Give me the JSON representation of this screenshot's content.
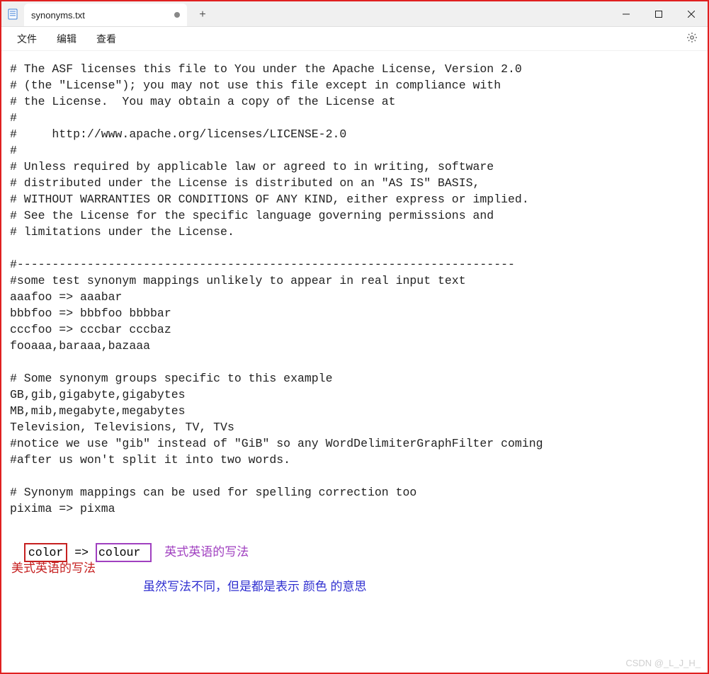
{
  "titlebar": {
    "tab_title": "synonyms.txt",
    "modified": true
  },
  "menu": {
    "file": "文件",
    "edit": "编辑",
    "view": "查看"
  },
  "content": {
    "lines": [
      "# The ASF licenses this file to You under the Apache License, Version 2.0",
      "# (the \"License\"); you may not use this file except in compliance with",
      "# the License.  You may obtain a copy of the License at",
      "#",
      "#     http://www.apache.org/licenses/LICENSE-2.0",
      "#",
      "# Unless required by applicable law or agreed to in writing, software",
      "# distributed under the License is distributed on an \"AS IS\" BASIS,",
      "# WITHOUT WARRANTIES OR CONDITIONS OF ANY KIND, either express or implied.",
      "# See the License for the specific language governing permissions and",
      "# limitations under the License.",
      "",
      "#-----------------------------------------------------------------------",
      "#some test synonym mappings unlikely to appear in real input text",
      "aaafoo => aaabar",
      "bbbfoo => bbbfoo bbbbar",
      "cccfoo => cccbar cccbaz",
      "fooaaa,baraaa,bazaaa",
      "",
      "# Some synonym groups specific to this example",
      "GB,gib,gigabyte,gigabytes",
      "MB,mib,megabyte,megabytes",
      "Television, Televisions, TV, TVs",
      "#notice we use \"gib\" instead of \"GiB\" so any WordDelimiterGraphFilter coming",
      "#after us won't split it into two words.",
      "",
      "# Synonym mappings can be used for spelling correction too",
      "pixima => pixma",
      ""
    ]
  },
  "highlighted_line": {
    "word1": "color",
    "arrow": " => ",
    "word2": "colour ",
    "note_right": "英式英语的写法"
  },
  "annotations": {
    "red_note": "美式英语的写法",
    "blue_note": "虽然写法不同，但是都是表示 颜色 的意思"
  },
  "watermark": "CSDN @_L_J_H_"
}
